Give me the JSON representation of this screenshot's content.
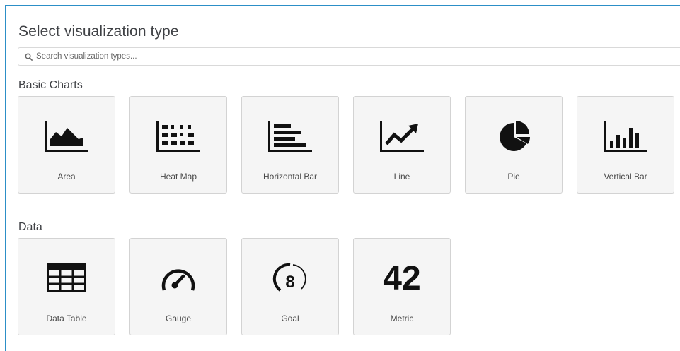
{
  "dialog": {
    "title": "Select visualization type"
  },
  "search": {
    "placeholder": "Search visualization types...",
    "value": "",
    "icon": "search-icon"
  },
  "sections": [
    {
      "title": "Basic Charts",
      "items": [
        {
          "label": "Area",
          "icon": "area-chart-icon"
        },
        {
          "label": "Heat Map",
          "icon": "heat-map-icon"
        },
        {
          "label": "Horizontal Bar",
          "icon": "horizontal-bar-chart-icon"
        },
        {
          "label": "Line",
          "icon": "line-chart-icon"
        },
        {
          "label": "Pie",
          "icon": "pie-chart-icon"
        },
        {
          "label": "Vertical Bar",
          "icon": "vertical-bar-chart-icon"
        }
      ]
    },
    {
      "title": "Data",
      "items": [
        {
          "label": "Data Table",
          "icon": "data-table-icon"
        },
        {
          "label": "Gauge",
          "icon": "gauge-icon"
        },
        {
          "label": "Goal",
          "icon": "goal-icon",
          "glyph": "8"
        },
        {
          "label": "Metric",
          "icon": "metric-icon",
          "glyph": "42"
        }
      ]
    }
  ],
  "colors": {
    "accent_border": "#2c8fc7",
    "card_background": "#f5f5f5",
    "card_border": "#d3d3d3",
    "icon": "#111111"
  }
}
